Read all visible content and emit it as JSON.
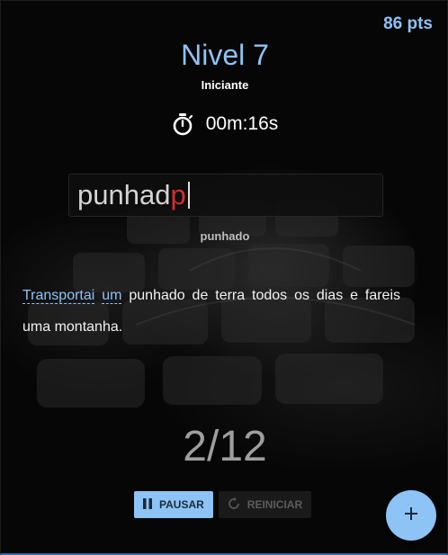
{
  "header": {
    "points": "86 pts",
    "level_title": "Nivel 7",
    "level_subtitle": "Iniciante"
  },
  "timer": {
    "icon": "stopwatch-icon",
    "value": "00m:16s"
  },
  "typing": {
    "correct_text": "punhad",
    "error_text": "p",
    "current_word": "punhado"
  },
  "phrase": {
    "completed_words": [
      "Transportai",
      "um"
    ],
    "remaining_text": "punhado de terra todos os dias e fareis uma montanha."
  },
  "progress": {
    "text": "2/12"
  },
  "controls": {
    "pause_label": "PAUSAR",
    "pause_icon": "pause-icon",
    "restart_label": "REINICIAR",
    "restart_icon": "restart-icon",
    "add_icon": "plus-icon"
  },
  "colors": {
    "accent": "#8ec3f5",
    "error": "#d32f2f",
    "background": "#060606"
  }
}
